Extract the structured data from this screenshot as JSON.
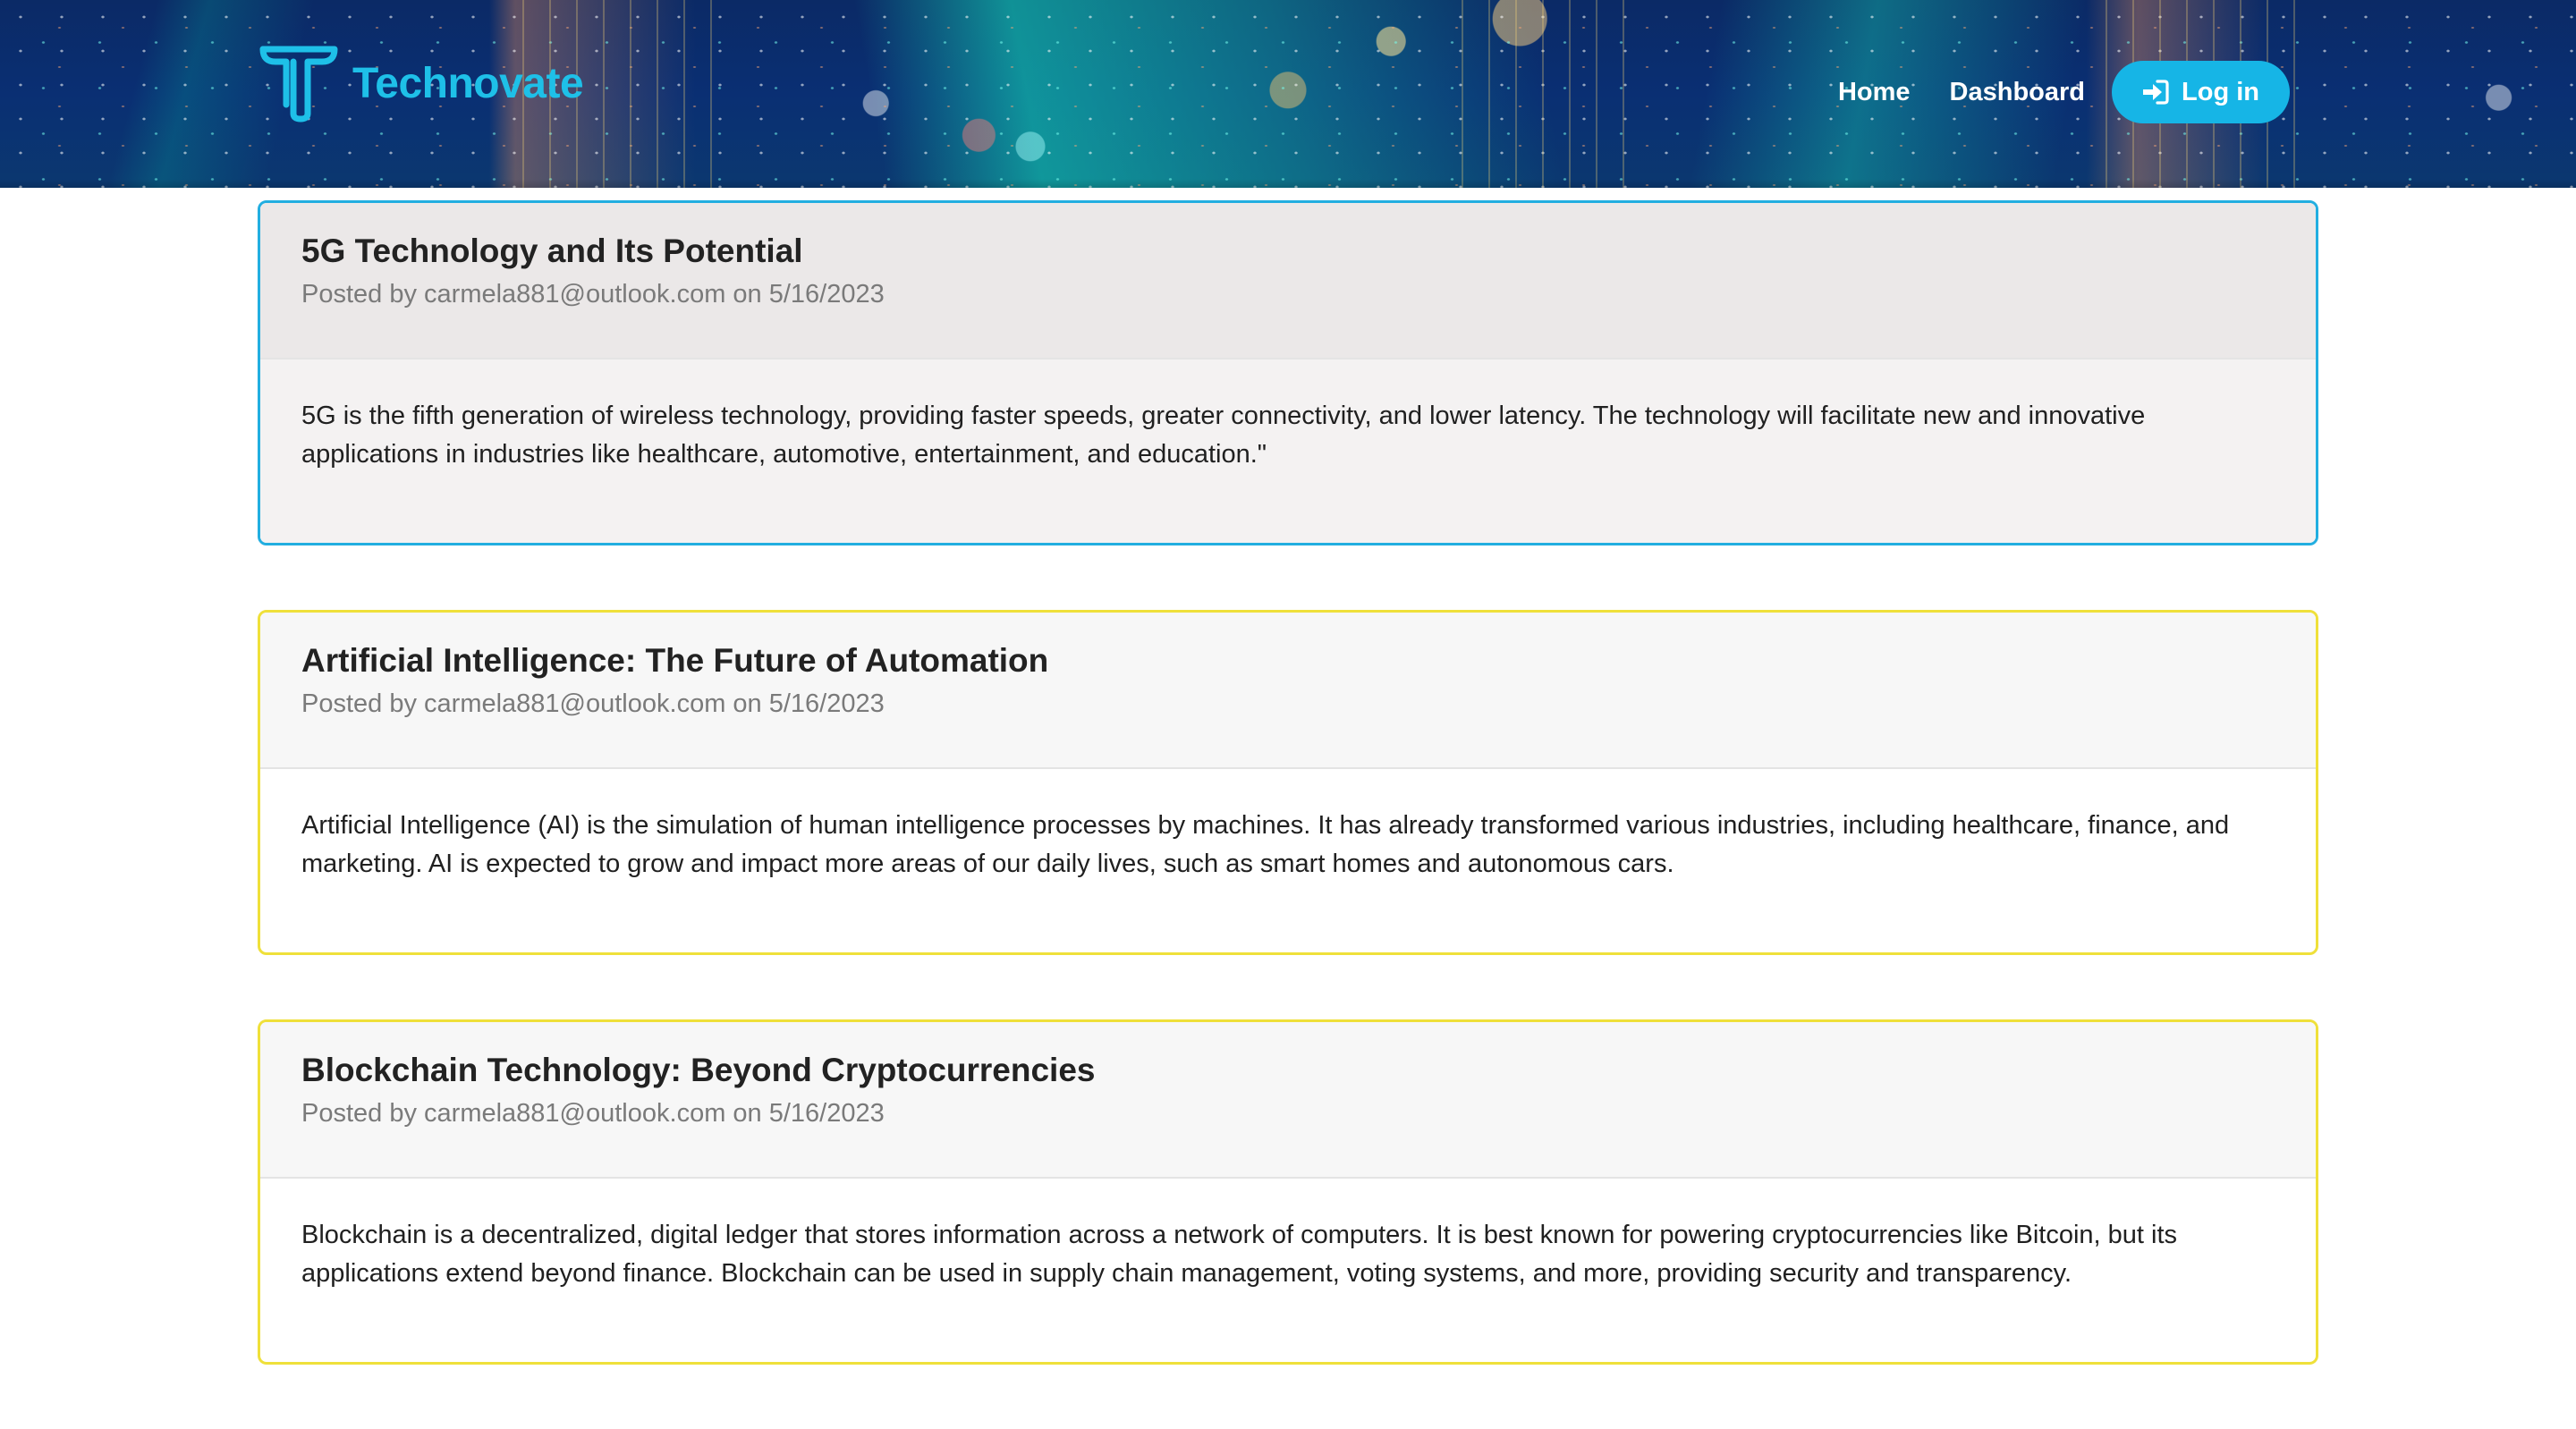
{
  "brand": {
    "name": "Technovate",
    "logo_icon": "t-logo-icon",
    "color": "#1ec0e8"
  },
  "nav": {
    "home_label": "Home",
    "dashboard_label": "Dashboard",
    "login_label": "Log in",
    "login_icon": "sign-in-icon",
    "accent_color": "#16b5e6"
  },
  "posts": [
    {
      "title": "5G Technology and Its Potential",
      "meta": "Posted by carmela881@outlook.com on 5/16/2023",
      "body": "5G is the fifth generation of wireless technology, providing faster speeds, greater connectivity, and lower latency. The technology will facilitate new and innovative applications in industries like healthcare, automotive, entertainment, and education.\"",
      "border_color": "#22aee0"
    },
    {
      "title": "Artificial Intelligence: The Future of Automation",
      "meta": "Posted by carmela881@outlook.com on 5/16/2023",
      "body": "Artificial Intelligence (AI) is the simulation of human intelligence processes by machines. It has already transformed various industries, including healthcare, finance, and marketing. AI is expected to grow and impact more areas of our daily lives, such as smart homes and autonomous cars.",
      "border_color": "#efe03a"
    },
    {
      "title": "Blockchain Technology: Beyond Cryptocurrencies",
      "meta": "Posted by carmela881@outlook.com on 5/16/2023",
      "body": "Blockchain is a decentralized, digital ledger that stores information across a network of computers. It is best known for powering cryptocurrencies like Bitcoin, but its applications extend beyond finance. Blockchain can be used in supply chain management, voting systems, and more, providing security and transparency.",
      "border_color": "#efe03a"
    }
  ]
}
